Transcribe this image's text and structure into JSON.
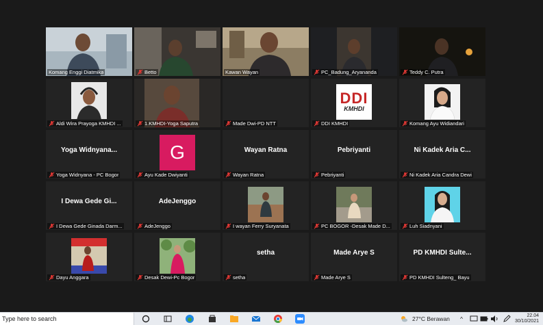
{
  "participants": [
    {
      "label": "Komang Enggi Diatmika",
      "speaking": true,
      "video": "wall"
    },
    {
      "label": "Betto",
      "video": "dim-room"
    },
    {
      "label": "Kawan Wayan",
      "video": "temple"
    },
    {
      "label": "PC_Badung_Aryananda",
      "video": "dark"
    },
    {
      "label": "Teddy C. Putra",
      "video": "night"
    },
    {
      "label": "Aldi Wira Prayoga KMHDI ...",
      "thumb": "headset"
    },
    {
      "label": "1.KMHDI-Yoga Saputra",
      "video": "wall2"
    },
    {
      "label": "Made Dwi-PD NTT",
      "video": "blank"
    },
    {
      "label": "DDI KMHDI",
      "thumb": "ddi",
      "logo_text": "DDI",
      "logo_subtext": "KMHDI"
    },
    {
      "label": "Komang Ayu Widiandari",
      "thumb": "portrait-white"
    },
    {
      "label": "Yoga Widnyana - PC Bogor",
      "display": "Yoga  Widnyana..."
    },
    {
      "label": "Ayu Kade Dwiyanti",
      "initial": "G"
    },
    {
      "label": "Wayan Ratna",
      "display": "Wayan Ratna"
    },
    {
      "label": "Pebriyanti",
      "display": "Pebriyanti"
    },
    {
      "label": "Ni Kadek Aria Candra Dewi",
      "display": "Ni Kadek Aria C..."
    },
    {
      "label": "I Dewa Gede Ginada Darm...",
      "display": "I Dewa Gede Gi..."
    },
    {
      "label": "AdeJenggo",
      "display": "AdeJenggo"
    },
    {
      "label": "I wayan Ferry Suryanata",
      "thumb": "outdoor"
    },
    {
      "label": "PC BOGOR -Desak Made D...",
      "thumb": "street"
    },
    {
      "label": "Luh Siadnyani",
      "thumb": "portrait-blue"
    },
    {
      "label": "Dayu Anggara",
      "thumb": "banner"
    },
    {
      "label": "Desak Dewi-Pc Bogor",
      "thumb": "garden"
    },
    {
      "label": "setha",
      "display": "setha"
    },
    {
      "label": "Made Arye S",
      "display": "Made Arye S"
    },
    {
      "label": "PD KMHDI Sulteng_ Bayu",
      "display": "PD KMHDI Sulte..."
    }
  ],
  "taskbar": {
    "search_placeholder": "Type here to search",
    "weather": "27°C  Berawan",
    "time": "22.04",
    "date": "30/10/2021"
  },
  "colors": {
    "background": "#1a1a1a",
    "tile": "#232323",
    "speaker_outline": "#e8e34a",
    "avatar": "#d81b60"
  }
}
